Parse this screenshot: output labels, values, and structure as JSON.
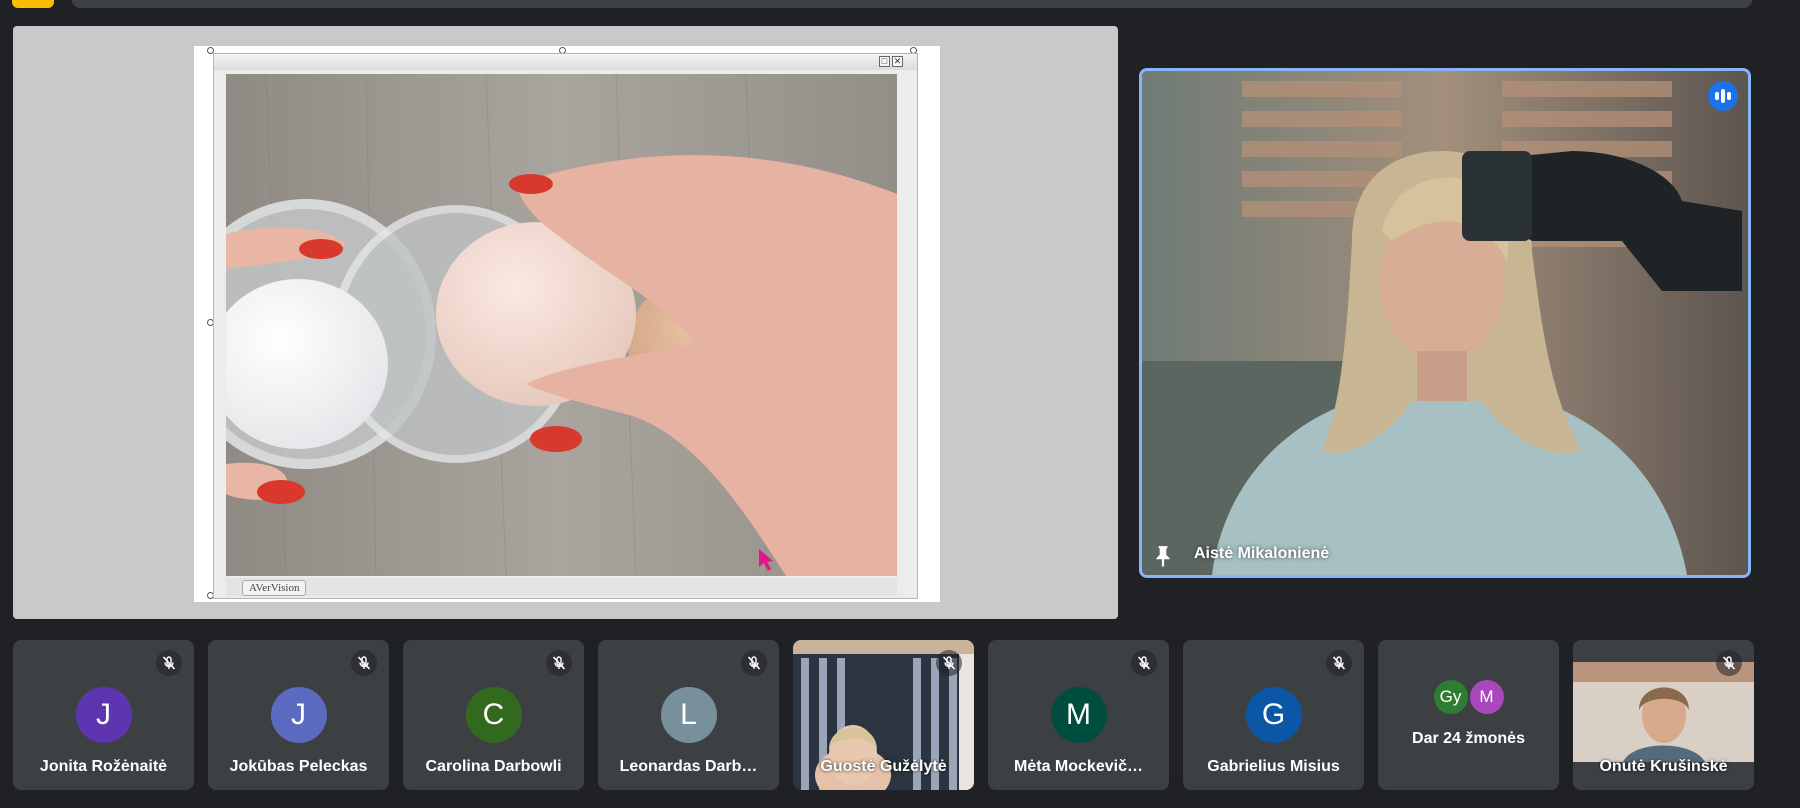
{
  "presentation": {
    "window_label": "AVerVision",
    "minimize_glyph": "□",
    "close_glyph": "✕"
  },
  "speaker": {
    "name": "Aistė Mikalonienė",
    "pin_icon": "pin-icon",
    "speaking_icon": "audio-indicator-icon",
    "border_color": "#8ab4f8"
  },
  "participants": [
    {
      "initial": "J",
      "name": "Jonita Rožėnaitė",
      "color": "#5e35b1",
      "muted": true
    },
    {
      "initial": "J",
      "name": "Jokūbas Peleckas",
      "color": "#5c6bc0",
      "muted": true
    },
    {
      "initial": "C",
      "name": "Carolina Darbowli",
      "color": "#33691e",
      "muted": true
    },
    {
      "initial": "L",
      "name": "Leonardas Darb…",
      "color": "#78909c",
      "muted": true
    },
    {
      "initial": "",
      "name": "Guostė Gužėlytė",
      "color": "",
      "muted": true,
      "video": true
    },
    {
      "initial": "M",
      "name": "Mėta Mockevič…",
      "color": "#004d40",
      "muted": true
    },
    {
      "initial": "G",
      "name": "Gabrielius Misius",
      "color": "#0b57a6",
      "muted": true
    }
  ],
  "more": {
    "avatars": [
      {
        "initial": "Gy",
        "color": "#2e7d32"
      },
      {
        "initial": "M",
        "color": "#ab47bc"
      }
    ],
    "label": "Dar 24 žmonės"
  },
  "last_participant": {
    "name": "Onutė Krušinskė",
    "muted": true
  },
  "colors": {
    "background": "#202124",
    "tile": "#3c4043",
    "accent_yellow": "#fbbc04"
  }
}
